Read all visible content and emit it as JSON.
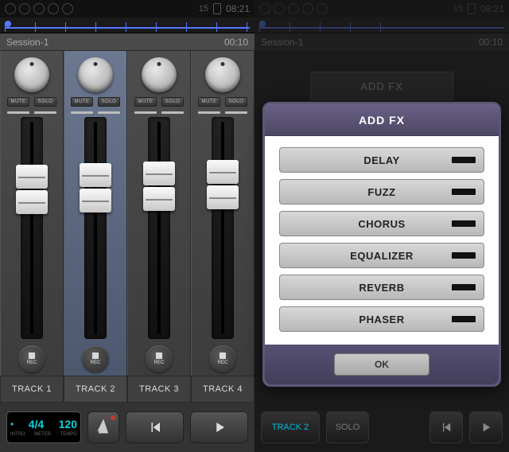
{
  "status": {
    "battery": "15",
    "time": "08:21"
  },
  "left": {
    "session_name": "Session-1",
    "session_time": "00:10",
    "channels": [
      {
        "mute": "MUTE",
        "solo": "SOLO",
        "rec": "REC",
        "selected": false
      },
      {
        "mute": "MUTE",
        "solo": "SOLO",
        "rec": "REC",
        "selected": true
      },
      {
        "mute": "MUTE",
        "solo": "SOLO",
        "rec": "REC",
        "selected": false
      },
      {
        "mute": "MUTE",
        "solo": "SOLO",
        "rec": "REC",
        "selected": false
      }
    ],
    "track_labels": [
      "TRACK 1",
      "TRACK 2",
      "TRACK 3",
      "TRACK 4"
    ],
    "tempo": {
      "signature": "4/4",
      "bpm": "120",
      "sub1": "INTRO",
      "sub2": "METER",
      "sub3": "TEMPO"
    }
  },
  "right": {
    "session_name": "Session-1",
    "session_time": "00:10",
    "hidden_button": "ADD FX",
    "bottom_track": "TRACK 2",
    "bottom_solo": "SOLO",
    "modal": {
      "title": "ADD FX",
      "options": [
        "DELAY",
        "FUZZ",
        "CHORUS",
        "EQUALIZER",
        "REVERB",
        "PHASER"
      ],
      "ok": "OK"
    }
  }
}
